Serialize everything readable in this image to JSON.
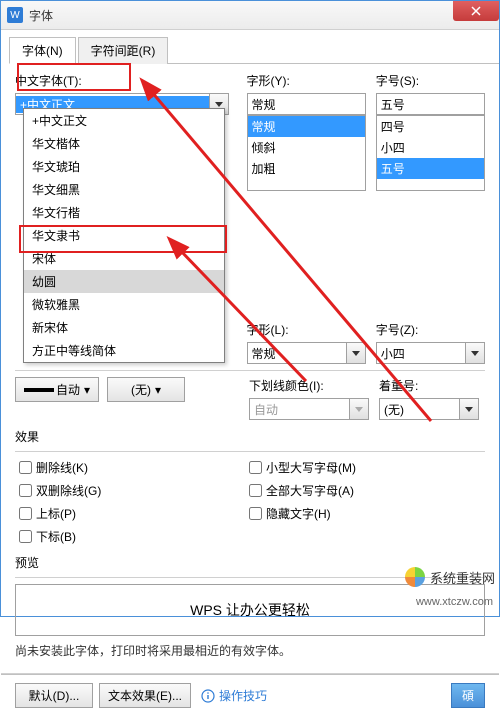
{
  "window": {
    "title": "字体",
    "app_icon_letter": "W"
  },
  "tabs": {
    "font": "字体(N)",
    "spacing": "字符间距(R)"
  },
  "labels": {
    "chinese_font": "中文字体(T):",
    "style": "字形(Y):",
    "size": "字号(S):",
    "latin_style": "字形(L):",
    "latin_size": "字号(Z):",
    "underline_color": "下划线颜色(I):",
    "emphasis": "着重号:",
    "effects": "效果",
    "preview": "预览"
  },
  "chinese_font": {
    "value": "+中文正文"
  },
  "font_dropdown": {
    "items": [
      "+中文正文",
      "华文楷体",
      "华文琥珀",
      "华文细黑",
      "华文行楷",
      "华文隶书",
      "宋体",
      "幼圆",
      "微软雅黑",
      "新宋体",
      "方正中等线简体"
    ],
    "hover_index": 7
  },
  "style": {
    "value": "常规",
    "list": [
      "常规",
      "倾斜",
      "加粗"
    ],
    "selected_index": 0
  },
  "size": {
    "value": "五号",
    "list": [
      "四号",
      "小四",
      "五号"
    ],
    "selected_index": 2
  },
  "latin_style": {
    "value": "常规"
  },
  "latin_size": {
    "value": "小四"
  },
  "color_btn": {
    "auto": "自动",
    "none": "(无)"
  },
  "underline_color": {
    "value": "自动"
  },
  "emphasis": {
    "value": "(无)"
  },
  "effects": {
    "strike": "删除线(K)",
    "dstrike": "双删除线(G)",
    "super": "上标(P)",
    "sub": "下标(B)",
    "smallcaps": "小型大写字母(M)",
    "allcaps": "全部大写字母(A)",
    "hidden": "隐藏文字(H)"
  },
  "preview_text": "WPS 让办公更轻松",
  "note": "尚未安装此字体，打印时将采用最相近的有效字体。",
  "buttons": {
    "default": "默认(D)...",
    "text_effect": "文本效果(E)...",
    "tips": "操作技巧"
  },
  "watermark": {
    "text": "系统重装网",
    "url": "www.xtczw.com"
  }
}
